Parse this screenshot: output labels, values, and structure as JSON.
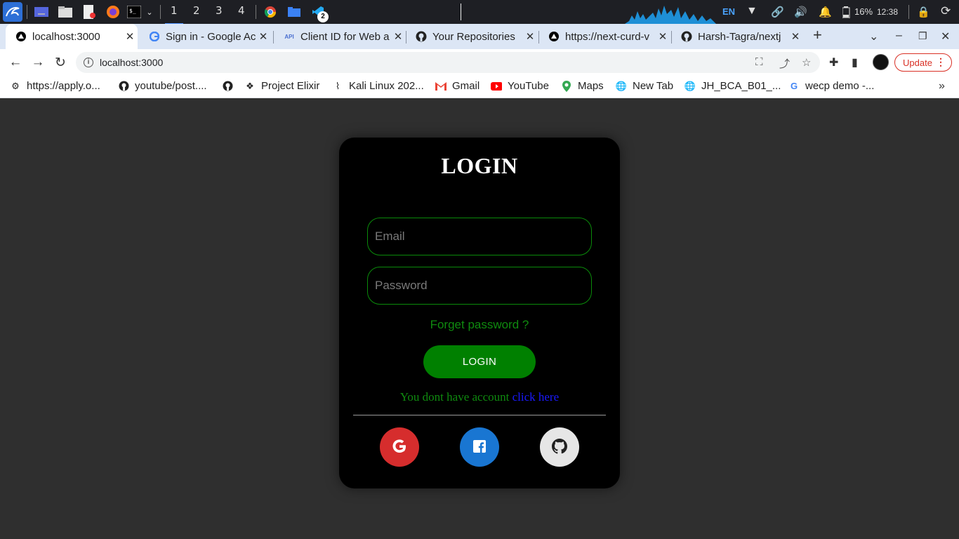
{
  "taskbar": {
    "workspaces": [
      "1",
      "2",
      "3",
      "4"
    ],
    "badge": "2",
    "language": "EN",
    "battery": "16%",
    "clock": "12:38"
  },
  "tabs": [
    {
      "title": "localhost:3000",
      "icon": "nextjs-icon"
    },
    {
      "title": "Sign in - Google Ac",
      "icon": "google-icon"
    },
    {
      "title": "Client ID for Web a",
      "icon": "api-icon"
    },
    {
      "title": "Your Repositories",
      "icon": "github-icon"
    },
    {
      "title": "https://next-curd-v",
      "icon": "vercel-icon"
    },
    {
      "title": "Harsh-Tagra/nextj",
      "icon": "github-icon"
    }
  ],
  "omnibox": {
    "url": "localhost:3000"
  },
  "update_label": "Update",
  "bookmarks": [
    {
      "label": "https://apply.o...",
      "icon": "gear-icon"
    },
    {
      "label": "youtube/post....",
      "icon": "github-icon"
    },
    {
      "label": "",
      "icon": "github-icon"
    },
    {
      "label": "Project Elixir",
      "icon": "elixir-icon"
    },
    {
      "label": "Kali Linux 202...",
      "icon": "kali-icon"
    },
    {
      "label": "Gmail",
      "icon": "gmail-icon"
    },
    {
      "label": "YouTube",
      "icon": "youtube-icon"
    },
    {
      "label": "Maps",
      "icon": "maps-icon"
    },
    {
      "label": "New Tab",
      "icon": "globe-icon"
    },
    {
      "label": "JH_BCA_B01_...",
      "icon": "globe-icon"
    },
    {
      "label": "wecp demo -...",
      "icon": "google-icon"
    }
  ],
  "login": {
    "title": "LOGIN",
    "email_placeholder": "Email",
    "password_placeholder": "Password",
    "forgot": "Forget password ?",
    "button": "LOGIN",
    "signup_text": "You dont have account ",
    "signup_link": "click here"
  },
  "colors": {
    "page_bg": "#2f2f2f",
    "card_bg": "#000000",
    "accent_green": "#008000",
    "google": "#d62d2d",
    "facebook": "#1976d2",
    "github": "#e6e6e6"
  }
}
